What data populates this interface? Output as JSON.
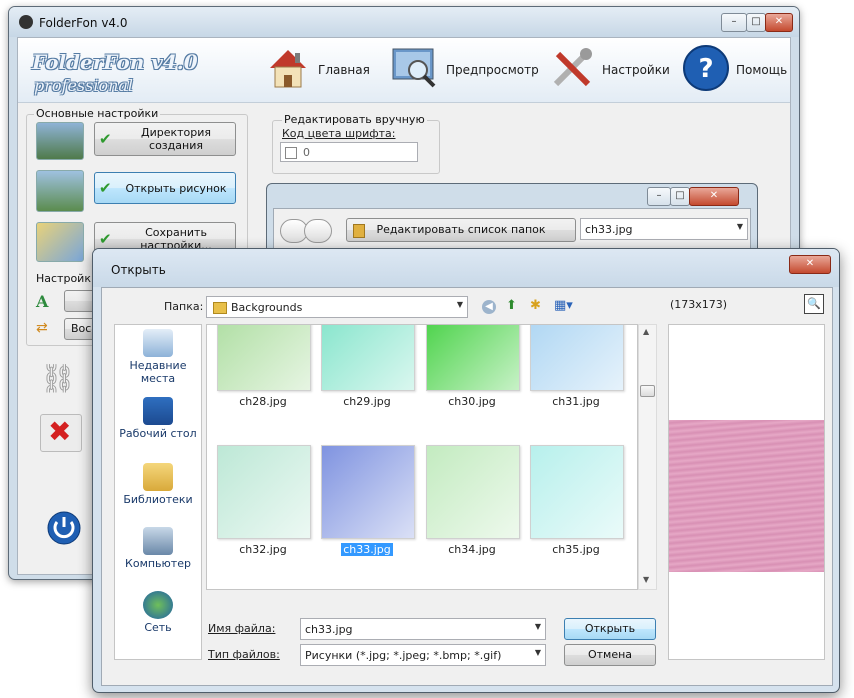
{
  "main": {
    "title": "FolderFon v4.0",
    "logo_line1": "FolderFon v4.0",
    "logo_line2": "professional",
    "nav": [
      {
        "label": "Главная",
        "icon": "home-icon"
      },
      {
        "label": "Предпросмотр",
        "icon": "preview-magnifier-icon"
      },
      {
        "label": "Настройки",
        "icon": "tools-icon"
      },
      {
        "label": "Помощь",
        "icon": "help-icon"
      }
    ],
    "caption": {
      "minimize": "–",
      "maximize": "□",
      "close": "✕"
    }
  },
  "basic_settings": {
    "title": "Основные настройки",
    "btn_dir": "Директория создания",
    "btn_open": "Открыть рисунок",
    "btn_save": "Сохранить настройки..."
  },
  "settings2": {
    "title": "Настройки",
    "restore_prefix": "Восст",
    "u_prefix": "У"
  },
  "manual": {
    "title": "Редактировать вручную",
    "font_color_label": "Код цвета шрифта:",
    "font_color_value": "0"
  },
  "mini_window": {
    "edit_folders_btn": "Редактировать список папок",
    "selected_file": "ch33.jpg"
  },
  "open_dialog": {
    "title": "Открыть",
    "folder_label": "Папка:",
    "folder_value": "Backgrounds",
    "preview_size": "(173x173)",
    "places": [
      {
        "label": "Недавние места",
        "icon": "recent-places-icon"
      },
      {
        "label": "Рабочий стол",
        "icon": "desktop-icon"
      },
      {
        "label": "Библиотеки",
        "icon": "libraries-icon"
      },
      {
        "label": "Компьютер",
        "icon": "computer-icon"
      },
      {
        "label": "Сеть",
        "icon": "network-icon"
      }
    ],
    "files": [
      {
        "name": "ch28.jpg",
        "color": "#a9dc9c"
      },
      {
        "name": "ch29.jpg",
        "color": "#7de3c8"
      },
      {
        "name": "ch30.jpg",
        "color": "#3ccf3a"
      },
      {
        "name": "ch31.jpg",
        "color": "#a8d3f2"
      },
      {
        "name": "ch32.jpg",
        "color": "#bde8d6"
      },
      {
        "name": "ch33.jpg",
        "color": "#7f93e0"
      },
      {
        "name": "ch34.jpg",
        "color": "#c3ebc0"
      },
      {
        "name": "ch35.jpg",
        "color": "#b7f0ec"
      },
      {
        "name": "",
        "color": "#6fd3e0"
      },
      {
        "name": "",
        "color": "#d4f0c4"
      },
      {
        "name": "",
        "color": "#e8e8e8"
      },
      {
        "name": "",
        "color": "#d8d8d8"
      }
    ],
    "selected_index": 5,
    "filename_label": "Имя файла:",
    "filename_value": "ch33.jpg",
    "filetype_label": "Тип файлов:",
    "filetype_value": "Рисунки (*.jpg; *.jpeg; *.bmp; *.gif)",
    "open_btn": "Открыть",
    "cancel_btn": "Отмена",
    "close_btn": "✕",
    "preview_color": "#e6a8c6"
  }
}
